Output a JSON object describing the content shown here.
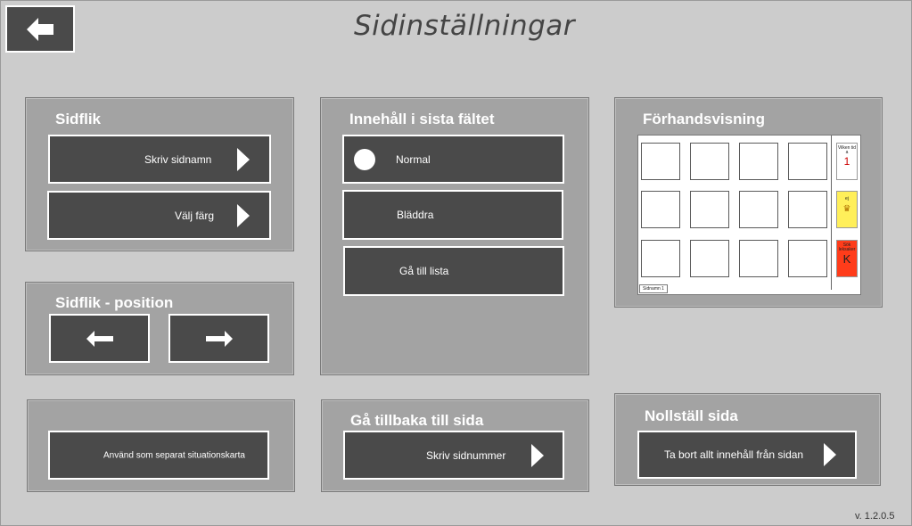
{
  "header": {
    "title": "Sidinställningar",
    "back_icon": "arrow-left-icon"
  },
  "sidflik": {
    "title": "Sidflik",
    "write_name_label": "Skriv sidnamn",
    "choose_color_label": "Välj färg"
  },
  "sidflik_position": {
    "title": "Sidflik - position"
  },
  "last_field": {
    "title": "Innehåll i sista fältet",
    "options": [
      "Normal",
      "Bläddra",
      "Gå till lista"
    ],
    "selected": "Normal"
  },
  "preview": {
    "title": "Förhandsvisning",
    "tab_label": "Sidnamn 1",
    "side_cards": [
      {
        "text": "Vilken tid a",
        "glyph": "1",
        "color": "#ffffff"
      },
      {
        "text": "ej",
        "glyph": "♛",
        "color": "#ffef5a"
      },
      {
        "text": "Sök leksaker",
        "glyph": "K",
        "color": "#ff3c1a"
      }
    ]
  },
  "separate_map": {
    "label": "Använd som separat situationskarta"
  },
  "go_back_page": {
    "title": "Gå tillbaka till sida",
    "button_label": "Skriv sidnummer"
  },
  "reset_page": {
    "title": "Nollställ sida",
    "button_label": "Ta bort allt innehåll från sidan"
  },
  "version": "v.  1.2.0.5"
}
